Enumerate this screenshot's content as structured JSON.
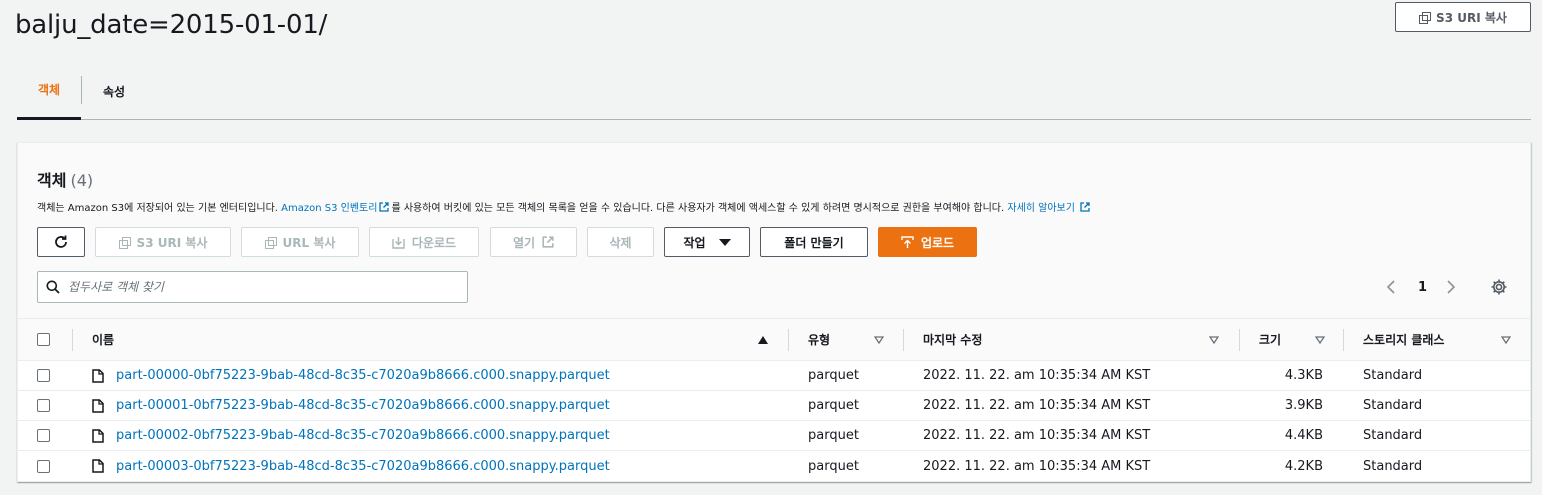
{
  "page": {
    "title": "balju_date=2015-01-01/",
    "copy_uri_label": "S3 URI 복사"
  },
  "tabs": [
    {
      "label": "객체",
      "active": true
    },
    {
      "label": "속성",
      "active": false
    }
  ],
  "panel": {
    "title": "객체",
    "count": "(4)",
    "desc_pre": "객체는 Amazon S3에 저장되어 있는 기본 엔터티입니다. ",
    "desc_link1": "Amazon S3 인벤토리",
    "desc_mid": "를 사용하여 버킷에 있는 모든 객체의 목록을 얻을 수 있습니다. 다른 사용자가 객체에 액세스할 수 있게 하려면 명시적으로 권한을 부여해야 합니다. ",
    "desc_link2": "자세히 알아보기"
  },
  "toolbar": {
    "refresh_icon": "refresh-icon",
    "copy_s3_uri": "S3 URI 복사",
    "copy_url": "URL 복사",
    "download": "다운로드",
    "open": "열기",
    "delete": "삭제",
    "actions": "작업",
    "create_folder": "폴더 만들기",
    "upload": "업로드"
  },
  "search": {
    "placeholder": "접두사로 객체 찾기"
  },
  "pagination": {
    "current_page": "1"
  },
  "colors": {
    "accent": "#ec7211",
    "link": "#0073bb"
  },
  "table": {
    "columns": [
      "이름",
      "유형",
      "마지막 수정",
      "크기",
      "스토리지 클래스"
    ],
    "rows": [
      {
        "name": "part-00000-0bf75223-9bab-48cd-8c35-c7020a9b8666.c000.snappy.parquet",
        "type": "parquet",
        "modified": "2022. 11. 22. am 10:35:34 AM KST",
        "size": "4.3KB",
        "storage": "Standard"
      },
      {
        "name": "part-00001-0bf75223-9bab-48cd-8c35-c7020a9b8666.c000.snappy.parquet",
        "type": "parquet",
        "modified": "2022. 11. 22. am 10:35:34 AM KST",
        "size": "3.9KB",
        "storage": "Standard"
      },
      {
        "name": "part-00002-0bf75223-9bab-48cd-8c35-c7020a9b8666.c000.snappy.parquet",
        "type": "parquet",
        "modified": "2022. 11. 22. am 10:35:34 AM KST",
        "size": "4.4KB",
        "storage": "Standard"
      },
      {
        "name": "part-00003-0bf75223-9bab-48cd-8c35-c7020a9b8666.c000.snappy.parquet",
        "type": "parquet",
        "modified": "2022. 11. 22. am 10:35:34 AM KST",
        "size": "4.2KB",
        "storage": "Standard"
      }
    ]
  }
}
